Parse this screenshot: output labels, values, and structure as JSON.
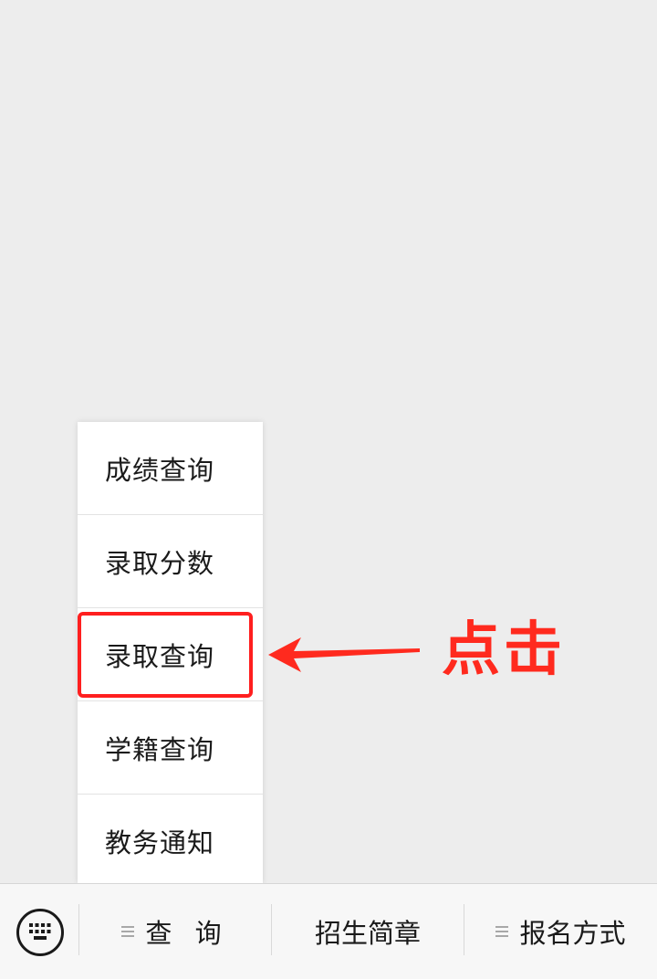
{
  "submenu": {
    "items": [
      {
        "label": "成绩查询"
      },
      {
        "label": "录取分数"
      },
      {
        "label": "录取查询"
      },
      {
        "label": "学籍查询"
      },
      {
        "label": "教务通知"
      }
    ],
    "highlighted_index": 2
  },
  "annotation": {
    "label": "点击",
    "color": "#ff2a1e"
  },
  "menu_bar": {
    "keyboard_icon": "keyboard-icon",
    "buttons": [
      {
        "label": "查 询",
        "has_submenu": true
      },
      {
        "label": "招生简章",
        "has_submenu": false
      },
      {
        "label": "报名方式",
        "has_submenu": true
      }
    ]
  }
}
